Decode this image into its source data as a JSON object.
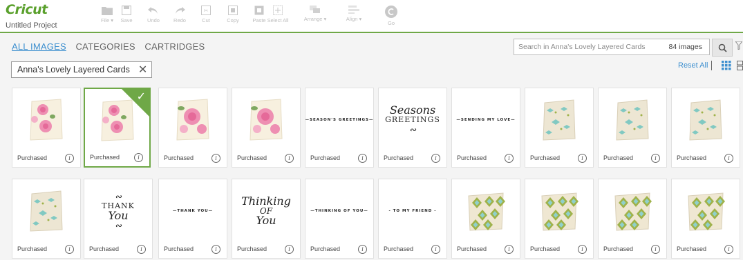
{
  "app": {
    "logo": "Cricut",
    "project_name": "Untitled Project"
  },
  "toolbar": [
    {
      "label": "File ▾",
      "icon": "folder-icon"
    },
    {
      "label": "Save",
      "icon": "save-icon"
    },
    {
      "label": "Undo",
      "icon": "undo-icon"
    },
    {
      "label": "Redo",
      "icon": "redo-icon"
    },
    {
      "label": "Cut",
      "icon": "cut-icon"
    },
    {
      "label": "Copy",
      "icon": "copy-icon"
    },
    {
      "label": "Paste",
      "icon": "paste-icon"
    },
    {
      "label": "Select All",
      "icon": "select-all-icon"
    },
    {
      "label": "Arrange ▾",
      "icon": "arrange-icon"
    },
    {
      "label": "Align ▾",
      "icon": "align-icon"
    },
    {
      "label": "Go",
      "icon": "go-icon"
    }
  ],
  "tabs": [
    {
      "label": "ALL IMAGES",
      "active": true
    },
    {
      "label": "CATEGORIES",
      "active": false
    },
    {
      "label": "CARTRIDGES",
      "active": false
    }
  ],
  "search": {
    "placeholder": "Search in Anna's Lovely Layered Cards",
    "count": "84 images"
  },
  "filter_chip": {
    "label": "Anna's Lovely Layered Cards",
    "close": "✕"
  },
  "view": {
    "reset_label": "Reset All"
  },
  "colors": {
    "accent_green": "#6fa847",
    "link_blue": "#3d8fcf",
    "rose_pink": "#ee8fb2",
    "teal": "#6fc4c0",
    "diamond_green": "#9fb24a"
  },
  "cards": [
    {
      "status": "Purchased",
      "art": "rose-card",
      "selected": false
    },
    {
      "status": "Purchased",
      "art": "rose-card",
      "selected": true,
      "check": "✓"
    },
    {
      "status": "Purchased",
      "art": "rose-card-large",
      "selected": false
    },
    {
      "status": "Purchased",
      "art": "rose-card-large",
      "selected": false
    },
    {
      "status": "Purchased",
      "art": "text",
      "text": "—SEASON'S GREETINGS—",
      "selected": false
    },
    {
      "status": "Purchased",
      "art": "script",
      "lines": [
        "Seasons",
        "GREETINGS",
        "∾"
      ],
      "selected": false
    },
    {
      "status": "Purchased",
      "art": "text",
      "text": "—SENDING MY LOVE—",
      "selected": false
    },
    {
      "status": "Purchased",
      "art": "teal-card",
      "selected": false
    },
    {
      "status": "Purchased",
      "art": "teal-card",
      "selected": false
    },
    {
      "status": "Purchased",
      "art": "teal-card",
      "selected": false
    },
    {
      "status": "Purchased",
      "art": "teal-card",
      "selected": false
    },
    {
      "status": "Purchased",
      "art": "script",
      "lines": [
        "∾",
        "THANK",
        "You",
        "∾"
      ],
      "selected": false
    },
    {
      "status": "Purchased",
      "art": "text",
      "text": "—THANK YOU—",
      "selected": false
    },
    {
      "status": "Purchased",
      "art": "script",
      "lines": [
        "Thinking",
        "OF",
        "You"
      ],
      "selected": false
    },
    {
      "status": "Purchased",
      "art": "text",
      "text": "—THINKING OF YOU—",
      "selected": false
    },
    {
      "status": "Purchased",
      "art": "text",
      "text": "- TO MY FRIEND -",
      "selected": false
    },
    {
      "status": "Purchased",
      "art": "diamond-card",
      "selected": false
    },
    {
      "status": "Purchased",
      "art": "diamond-card",
      "selected": false
    },
    {
      "status": "Purchased",
      "art": "diamond-card",
      "selected": false
    },
    {
      "status": "Purchased",
      "art": "diamond-card",
      "selected": false
    }
  ],
  "info_glyph": "i"
}
